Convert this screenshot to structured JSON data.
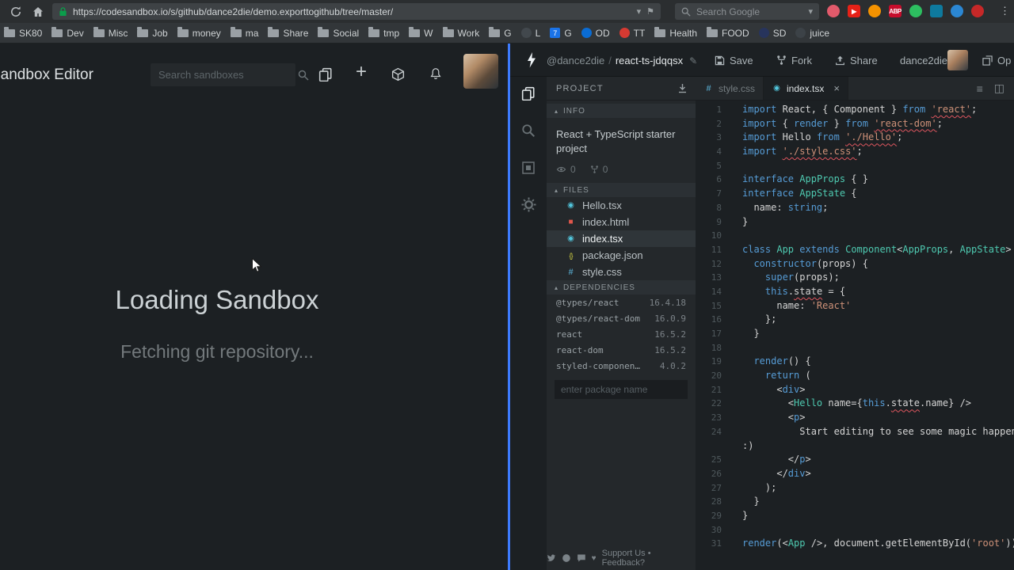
{
  "browser": {
    "url": "https://codesandbox.io/s/github/dance2die/demo.exporttogithub/tree/master/",
    "search_placeholder": "Search Google",
    "bookmarks": [
      {
        "label": "SK80",
        "icon": "folder"
      },
      {
        "label": "Dev",
        "icon": "folder"
      },
      {
        "label": "Misc",
        "icon": "folder"
      },
      {
        "label": "Job",
        "icon": "folder"
      },
      {
        "label": "money",
        "icon": "folder"
      },
      {
        "label": "ma",
        "icon": "folder"
      },
      {
        "label": "Share",
        "icon": "folder"
      },
      {
        "label": "Social",
        "icon": "folder"
      },
      {
        "label": "tmp",
        "icon": "folder"
      },
      {
        "label": "W",
        "icon": "folder"
      },
      {
        "label": "Work",
        "icon": "folder"
      },
      {
        "label": "G",
        "icon": "folder"
      },
      {
        "label": "L",
        "icon": "dot",
        "color": "#42484d"
      },
      {
        "label": "G",
        "icon": "badge",
        "color": "#1a73e8",
        "badge": "7"
      },
      {
        "label": "OD",
        "icon": "dot",
        "color": "#0a6cd4"
      },
      {
        "label": "TT",
        "icon": "dot",
        "color": "#d63a32"
      },
      {
        "label": "Health",
        "icon": "folder"
      },
      {
        "label": "FOOD",
        "icon": "folder"
      },
      {
        "label": "SD",
        "icon": "dot",
        "color": "#27345c"
      },
      {
        "label": "juice",
        "icon": "dot",
        "color": "#3c4247"
      }
    ],
    "extensions": [
      {
        "color": "#e25a6b",
        "shape": "circle",
        "glyph": ""
      },
      {
        "color": "#e62117",
        "shape": "square",
        "glyph": "▶"
      },
      {
        "color": "#f59300",
        "shape": "circle",
        "glyph": ""
      },
      {
        "color": "#c70d2c",
        "shape": "square",
        "glyph": "ABP"
      },
      {
        "color": "#2dbe60",
        "shape": "circle",
        "glyph": ""
      },
      {
        "color": "#0e7a9e",
        "shape": "square",
        "glyph": ""
      },
      {
        "color": "#2b87d3",
        "shape": "circle",
        "glyph": ""
      },
      {
        "color": "#c62828",
        "shape": "circle",
        "glyph": ""
      }
    ]
  },
  "left": {
    "title": "Sandbox Editor",
    "search_placeholder": "Search sandboxes",
    "loading_title": "Loading Sandbox",
    "loading_sub": "Fetching git repository..."
  },
  "editor": {
    "header": {
      "user": "@dance2die",
      "sep": "/",
      "project": "react-ts-jdqqsx",
      "save": "Save",
      "fork": "Fork",
      "share": "Share",
      "account": "dance2die",
      "open": "Op"
    },
    "sidebar": {
      "project_label": "PROJECT",
      "info_label": "INFO",
      "description": "React + TypeScript starter project",
      "views": "0",
      "forks": "0",
      "files_label": "FILES",
      "files": [
        {
          "name": "Hello.tsx",
          "icon": "react",
          "selected": false
        },
        {
          "name": "index.html",
          "icon": "html",
          "selected": false
        },
        {
          "name": "index.tsx",
          "icon": "react",
          "selected": true
        },
        {
          "name": "package.json",
          "icon": "json",
          "selected": false
        },
        {
          "name": "style.css",
          "icon": "css",
          "selected": false
        }
      ],
      "deps_label": "DEPENDENCIES",
      "dependencies": [
        {
          "name": "@types/react",
          "version": "16.4.18"
        },
        {
          "name": "@types/react-dom",
          "version": "16.0.9"
        },
        {
          "name": "react",
          "version": "16.5.2"
        },
        {
          "name": "react-dom",
          "version": "16.5.2"
        },
        {
          "name": "styled-components",
          "version": "4.0.2"
        }
      ],
      "add_dep_placeholder": "enter package name",
      "footer": "Support Us • Feedback?"
    },
    "tabs": [
      {
        "name": "style.css",
        "active": false
      },
      {
        "name": "index.tsx",
        "active": true
      }
    ],
    "code": {
      "lines": [
        {
          "n": "1",
          "s": [
            [
              "k",
              "import"
            ],
            [
              "p",
              " React, { Component } "
            ],
            [
              "k",
              "from"
            ],
            [
              "p",
              " "
            ],
            [
              "se",
              "'react'"
            ],
            [
              "p",
              ";"
            ]
          ]
        },
        {
          "n": "2",
          "s": [
            [
              "k",
              "import"
            ],
            [
              "p",
              " { "
            ],
            [
              "k",
              "render"
            ],
            [
              "p",
              " } "
            ],
            [
              "k",
              "from"
            ],
            [
              "p",
              " "
            ],
            [
              "se",
              "'react-dom'"
            ],
            [
              "p",
              ";"
            ]
          ]
        },
        {
          "n": "3",
          "s": [
            [
              "k",
              "import"
            ],
            [
              "p",
              " Hello "
            ],
            [
              "k",
              "from"
            ],
            [
              "p",
              " "
            ],
            [
              "se",
              "'./Hello'"
            ],
            [
              "p",
              ";"
            ]
          ]
        },
        {
          "n": "4",
          "s": [
            [
              "k",
              "import"
            ],
            [
              "p",
              " "
            ],
            [
              "se",
              "'./style.css'"
            ],
            [
              "p",
              ";"
            ]
          ]
        },
        {
          "n": "5",
          "s": []
        },
        {
          "n": "6",
          "s": [
            [
              "k",
              "interface"
            ],
            [
              "p",
              " "
            ],
            [
              "t",
              "AppProps"
            ],
            [
              "p",
              " { }"
            ]
          ]
        },
        {
          "n": "7",
          "s": [
            [
              "k",
              "interface"
            ],
            [
              "p",
              " "
            ],
            [
              "t",
              "AppState"
            ],
            [
              "p",
              " {"
            ]
          ]
        },
        {
          "n": "8",
          "s": [
            [
              "p",
              "  name: "
            ],
            [
              "k",
              "string"
            ],
            [
              "p",
              ";"
            ]
          ]
        },
        {
          "n": "9",
          "s": [
            [
              "p",
              "}"
            ]
          ]
        },
        {
          "n": "10",
          "s": []
        },
        {
          "n": "11",
          "s": [
            [
              "k",
              "class"
            ],
            [
              "p",
              " "
            ],
            [
              "t",
              "App"
            ],
            [
              "p",
              " "
            ],
            [
              "k",
              "extends"
            ],
            [
              "p",
              " "
            ],
            [
              "t",
              "Component"
            ],
            [
              "p",
              "<"
            ],
            [
              "t",
              "AppProps"
            ],
            [
              "p",
              ", "
            ],
            [
              "t",
              "AppState"
            ],
            [
              "p",
              ">"
            ]
          ]
        },
        {
          "n": "12",
          "s": [
            [
              "p",
              "  "
            ],
            [
              "k",
              "constructor"
            ],
            [
              "p",
              "(props) {"
            ]
          ]
        },
        {
          "n": "13",
          "s": [
            [
              "p",
              "    "
            ],
            [
              "k",
              "super"
            ],
            [
              "p",
              "(props);"
            ]
          ]
        },
        {
          "n": "14",
          "s": [
            [
              "p",
              "    "
            ],
            [
              "k",
              "this"
            ],
            [
              "p",
              "."
            ],
            [
              "pe",
              "state"
            ],
            [
              "p",
              " = {"
            ]
          ]
        },
        {
          "n": "15",
          "s": [
            [
              "p",
              "      name: "
            ],
            [
              "s",
              "'React'"
            ]
          ]
        },
        {
          "n": "16",
          "s": [
            [
              "p",
              "    };"
            ]
          ]
        },
        {
          "n": "17",
          "s": [
            [
              "p",
              "  }"
            ]
          ]
        },
        {
          "n": "18",
          "s": []
        },
        {
          "n": "19",
          "s": [
            [
              "p",
              "  "
            ],
            [
              "k",
              "render"
            ],
            [
              "p",
              "() {"
            ]
          ]
        },
        {
          "n": "20",
          "s": [
            [
              "p",
              "    "
            ],
            [
              "k",
              "return"
            ],
            [
              "p",
              " ("
            ]
          ]
        },
        {
          "n": "21",
          "s": [
            [
              "p",
              "      <"
            ],
            [
              "k",
              "div"
            ],
            [
              "p",
              ">"
            ]
          ]
        },
        {
          "n": "22",
          "s": [
            [
              "p",
              "        <"
            ],
            [
              "t",
              "Hello"
            ],
            [
              "p",
              " name={"
            ],
            [
              "k",
              "this"
            ],
            [
              "p",
              "."
            ],
            [
              "pe",
              "state"
            ],
            [
              "p",
              ".name} />"
            ]
          ]
        },
        {
          "n": "23",
          "s": [
            [
              "p",
              "        <"
            ],
            [
              "k",
              "p"
            ],
            [
              "p",
              ">"
            ]
          ]
        },
        {
          "n": "24",
          "s": [
            [
              "p",
              "          Start editing to see some magic happen"
            ]
          ]
        },
        {
          "n": "",
          "s": [
            [
              "p",
              ":)"
            ]
          ]
        },
        {
          "n": "25",
          "s": [
            [
              "p",
              "        </"
            ],
            [
              "k",
              "p"
            ],
            [
              "p",
              ">"
            ]
          ]
        },
        {
          "n": "26",
          "s": [
            [
              "p",
              "      </"
            ],
            [
              "k",
              "div"
            ],
            [
              "p",
              ">"
            ]
          ]
        },
        {
          "n": "27",
          "s": [
            [
              "p",
              "    );"
            ]
          ]
        },
        {
          "n": "28",
          "s": [
            [
              "p",
              "  }"
            ]
          ]
        },
        {
          "n": "29",
          "s": [
            [
              "p",
              "}"
            ]
          ]
        },
        {
          "n": "30",
          "s": []
        },
        {
          "n": "31",
          "s": [
            [
              "k",
              "render"
            ],
            [
              "p",
              "(<"
            ],
            [
              "t",
              "App"
            ],
            [
              "p",
              " />, document.getElementById("
            ],
            [
              "s",
              "'root'"
            ],
            [
              "p",
              "))"
            ]
          ]
        }
      ]
    }
  },
  "icons": {
    "caret": "▾",
    "flag": "⚑",
    "section_arrow": "▴",
    "close": "×",
    "menu": "≡",
    "split": "◫",
    "pencil": "✎",
    "plus": "+",
    "heart": "♥",
    "dots": "⋮",
    "file": {
      "react": "◉",
      "html": "■",
      "json": "{}",
      "css": "#"
    }
  }
}
